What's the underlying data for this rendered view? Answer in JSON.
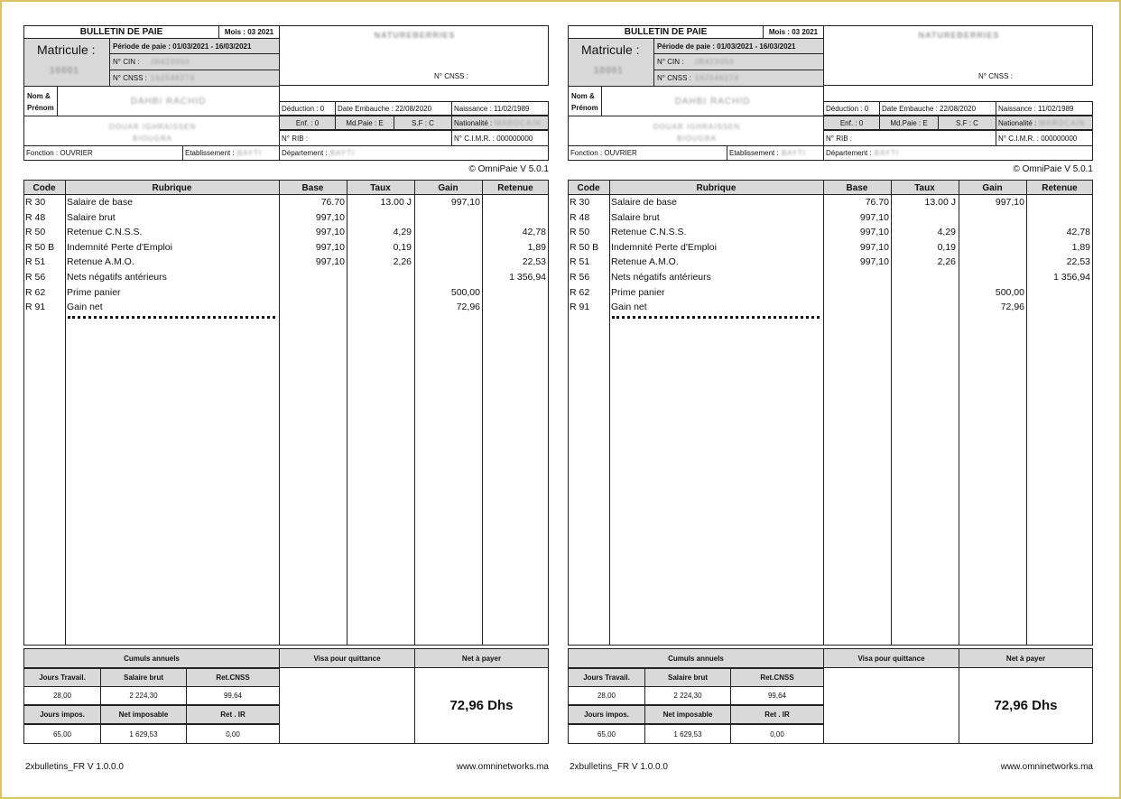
{
  "header": {
    "title": "BULLETIN DE PAIE",
    "mois": "Mois : 03 2021",
    "matricule_label": "Matricule :",
    "matricule_value": "10001",
    "periode": "Période de paie : 01/03/2021 - 16/03/2021",
    "cin_label": "N° CIN :",
    "cin_value": "JB423050",
    "cnss_label": "N° CNSS :",
    "cnss_value": "162546274",
    "company": "NATUREBERRIES",
    "company_cnss_label": "N° CNSS :",
    "nom_label": "Nom & Prénom",
    "nom_value": "DAHBI RACHID",
    "address_line1": "DOUAR IGHRAISSEN",
    "address_line2": "BIOUGRA",
    "deduction": "Déduction : 0",
    "embauche": "Date Embauche : 22/08/2020",
    "naissance": "Naissance : 11/02/1989",
    "enf": "Enf. : 0",
    "md_paie": "Md.Paie : E",
    "sf": "S.F : C",
    "nationalite_label": "Nationalité :",
    "nationalite_value": "MAROCAIN",
    "rib": "N° RIB :",
    "cimr": "N° C.I.M.R. : 000000000",
    "fonction": "Fonction : OUVRIER",
    "etab_label": "Etablissement :",
    "etab_value": "BAYTI",
    "dept_label": "Département :",
    "dept_value": "BAYTI",
    "copyright": "© OmniPaie V 5.0.1"
  },
  "table": {
    "columns": [
      "Code",
      "Rubrique",
      "Base",
      "Taux",
      "Gain",
      "Retenue"
    ],
    "rows": [
      {
        "code": "R 30",
        "rubrique": "Salaire de base",
        "base": "76.70",
        "taux": "13.00 J",
        "gain": "997,10",
        "retenue": ""
      },
      {
        "code": "R 48",
        "rubrique": "Salaire brut",
        "base": "997,10",
        "taux": "",
        "gain": "",
        "retenue": ""
      },
      {
        "code": "R 50",
        "rubrique": "Retenue C.N.S.S.",
        "base": "997,10",
        "taux": "4,29",
        "gain": "",
        "retenue": "42,78"
      },
      {
        "code": "R 50 B",
        "rubrique": "Indemnité Perte d'Emploi",
        "base": "997,10",
        "taux": "0,19",
        "gain": "",
        "retenue": "1,89"
      },
      {
        "code": "R 51",
        "rubrique": "Retenue A.M.O.",
        "base": "997,10",
        "taux": "2,26",
        "gain": "",
        "retenue": "22,53"
      },
      {
        "code": "R 56",
        "rubrique": "Nets négatifs antérieurs",
        "base": "",
        "taux": "",
        "gain": "",
        "retenue": "1 356,94"
      },
      {
        "code": "R 62",
        "rubrique": "Prime panier",
        "base": "",
        "taux": "",
        "gain": "500,00",
        "retenue": ""
      },
      {
        "code": "R 91",
        "rubrique": "Gain net",
        "base": "",
        "taux": "",
        "gain": "72,96",
        "retenue": ""
      }
    ]
  },
  "footer": {
    "cumuls_label": "Cumuls annuels",
    "visa_label": "Visa pour quittance",
    "net_label": "Net à payer",
    "net_value": "72,96 Dhs",
    "jours_travail_label": "Jours Travail.",
    "jours_travail_value": "28,00",
    "salaire_brut_label": "Salaire brut",
    "salaire_brut_value": "2 224,30",
    "ret_cnss_label": "Ret.CNSS",
    "ret_cnss_value": "99,64",
    "jours_impos_label": "Jours impos.",
    "jours_impos_value": "65,00",
    "net_imposable_label": "Net imposable",
    "net_imposable_value": "1 629,53",
    "ret_ir_label": "Ret . IR",
    "ret_ir_value": "0,00",
    "version": "2xbulletins_FR V 1.0.0.0",
    "website": "www.omninetworks.ma"
  }
}
